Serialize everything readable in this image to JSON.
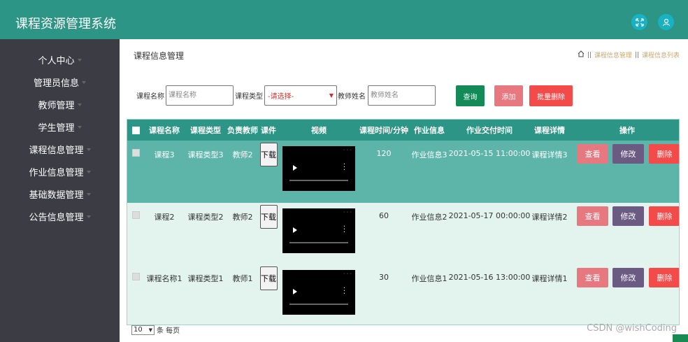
{
  "app": {
    "title": "课程资源管理系统"
  },
  "header_icons": [
    "fullscreen-icon",
    "user-icon"
  ],
  "sidebar": {
    "items": [
      {
        "label": "个人中心"
      },
      {
        "label": "管理员信息"
      },
      {
        "label": "教师管理"
      },
      {
        "label": "学生管理"
      },
      {
        "label": "课程信息管理"
      },
      {
        "label": "作业信息管理"
      },
      {
        "label": "基础数据管理"
      },
      {
        "label": "公告信息管理"
      }
    ]
  },
  "page": {
    "heading": "课程信息管理",
    "breadcrumb": [
      "课程信息管理",
      "课程信息列表"
    ]
  },
  "search": {
    "course_name_label": "课程名称",
    "course_name_placeholder": "课程名称",
    "course_type_label": "课程类型",
    "course_type_value": "-请选择-",
    "teacher_label": "教师姓名",
    "teacher_placeholder": "教师姓名",
    "query_label": "查询",
    "add_label": "添加",
    "batch_delete_label": "批量删除"
  },
  "table": {
    "headers": [
      "课程名称",
      "课程类型",
      "负责教师",
      "课件",
      "视频",
      "课程时间/分钟",
      "作业信息",
      "作业交付时间",
      "课程详情",
      "操作"
    ],
    "rows": [
      {
        "name": "课程3",
        "type": "课程类型3",
        "teacher": "教师2",
        "download": "下载",
        "minutes": "120",
        "homework": "作业信息3",
        "due": "2021-05-15 11:00:00",
        "detail": "课程详情3",
        "view": "查看",
        "edit": "修改",
        "delete": "删除"
      },
      {
        "name": "课程2",
        "type": "课程类型2",
        "teacher": "教师2",
        "download": "下载",
        "minutes": "60",
        "homework": "作业信息2",
        "due": "2021-05-17 00:00:00",
        "detail": "课程详情2",
        "view": "查看",
        "edit": "修改",
        "delete": "删除"
      },
      {
        "name": "课程名称1",
        "type": "课程类型1",
        "teacher": "教师1",
        "download": "下载",
        "minutes": "30",
        "homework": "作业信息1",
        "due": "2021-05-16 13:00:00",
        "detail": "课程详情1",
        "view": "查看",
        "edit": "修改",
        "delete": "删除"
      }
    ]
  },
  "pager": {
    "page_size": "10",
    "per_page_label": "条 每页"
  },
  "watermark": "CSDN @wishCoding",
  "colors": {
    "header": "#2c9585",
    "sidebar": "#3c3c44",
    "row_selected": "#5cb5a8",
    "row": "#e3f4ef"
  }
}
